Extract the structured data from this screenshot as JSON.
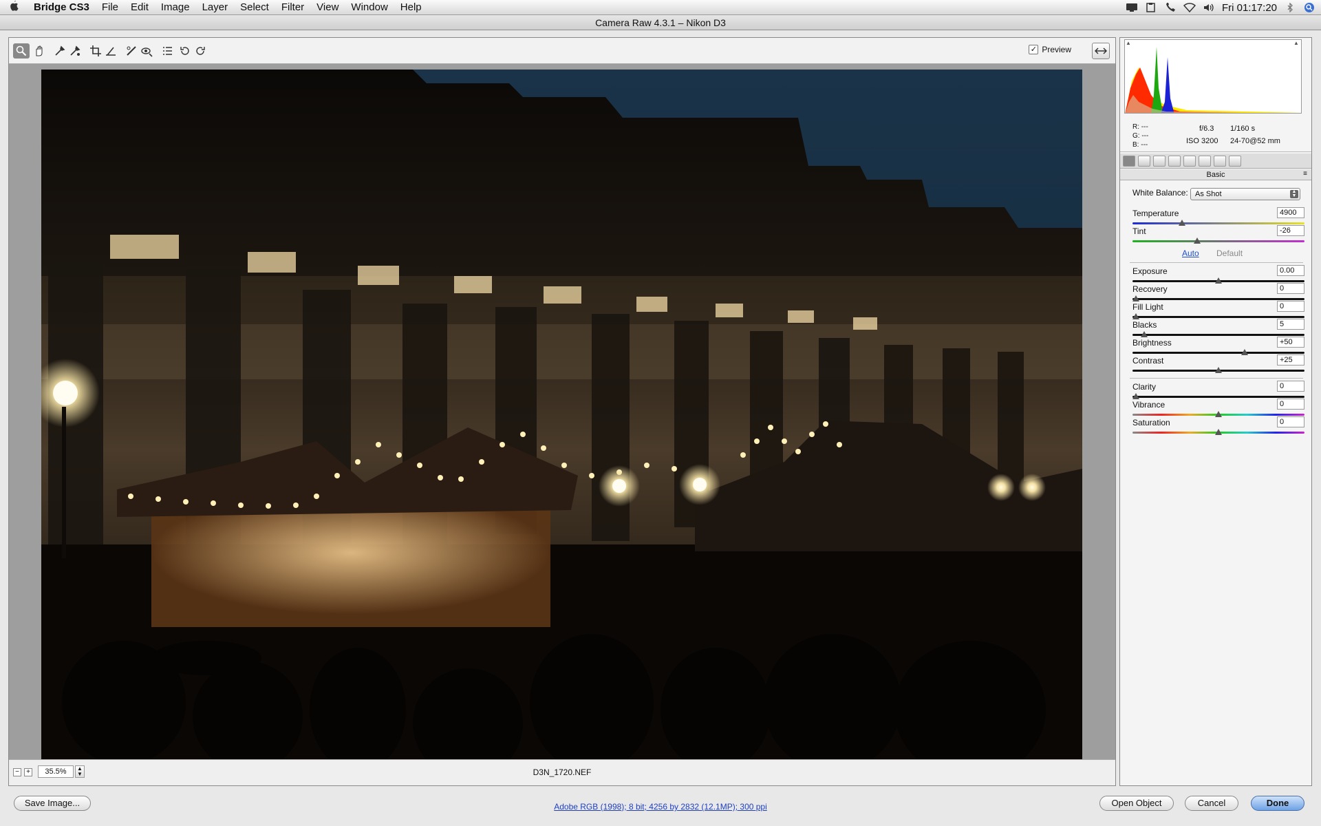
{
  "menubar": {
    "apple_icon": "apple-icon",
    "items": [
      "Bridge CS3",
      "File",
      "Edit",
      "Image",
      "Layer",
      "Select",
      "Filter",
      "View",
      "Window",
      "Help"
    ],
    "clock": "Fri 01:17:20",
    "tray_icons": [
      "display-icon",
      "clipboard-icon",
      "phone-icon",
      "wifi-icon",
      "volume-icon",
      "bluetooth-icon",
      "spotlight-icon"
    ]
  },
  "window": {
    "title": "Camera Raw 4.3.1  –  Nikon D3"
  },
  "toolbar": {
    "tools": [
      "zoom-icon",
      "hand-icon",
      "white-balance-icon",
      "color-sampler-icon",
      "crop-icon",
      "straighten-icon",
      "retouch-icon",
      "red-eye-icon",
      "preferences-icon",
      "rotate-left-icon",
      "rotate-right-icon"
    ],
    "preview_label": "Preview",
    "preview_checked": true
  },
  "status": {
    "zoom_minus": "−",
    "zoom_plus": "+",
    "zoom": "35.5%",
    "filename": "D3N_1720.NEF"
  },
  "info": {
    "r_label": "R:",
    "g_label": "G:",
    "b_label": "B:",
    "r_value": "---",
    "g_value": "---",
    "b_value": "---",
    "aperture": "f/6.3",
    "shutter": "1/160 s",
    "iso": "ISO 3200",
    "lens": "24-70@52 mm"
  },
  "panel": {
    "tab_icons": [
      "basic-icon",
      "tone-curve-icon",
      "detail-icon",
      "hsl-icon",
      "split-toning-icon",
      "lens-icon",
      "camera-calibration-icon",
      "presets-icon"
    ],
    "title": "Basic",
    "white_balance_label": "White Balance:",
    "white_balance_value": "As Shot",
    "auto_label": "Auto",
    "default_label": "Default",
    "sliders": [
      {
        "label": "Temperature",
        "value": "4900",
        "pos": 0.28
      },
      {
        "label": "Tint",
        "value": "-26",
        "pos": 0.37
      },
      {
        "label": "Exposure",
        "value": "0.00",
        "pos": 0.5
      },
      {
        "label": "Recovery",
        "value": "0",
        "pos": 0.0
      },
      {
        "label": "Fill Light",
        "value": "0",
        "pos": 0.0
      },
      {
        "label": "Blacks",
        "value": "5",
        "pos": 0.05
      },
      {
        "label": "Brightness",
        "value": "+50",
        "pos": 0.66
      },
      {
        "label": "Contrast",
        "value": "+25",
        "pos": 0.5
      },
      {
        "label": "Clarity",
        "value": "0",
        "pos": 0.0
      },
      {
        "label": "Vibrance",
        "value": "0",
        "pos": 0.5
      },
      {
        "label": "Saturation",
        "value": "0",
        "pos": 0.5
      }
    ]
  },
  "bottom": {
    "save_label": "Save Image...",
    "workflow_link": "Adobe RGB (1998); 8 bit; 4256 by 2832 (12.1MP); 300 ppi",
    "open_label": "Open Object",
    "cancel_label": "Cancel",
    "done_label": "Done"
  }
}
